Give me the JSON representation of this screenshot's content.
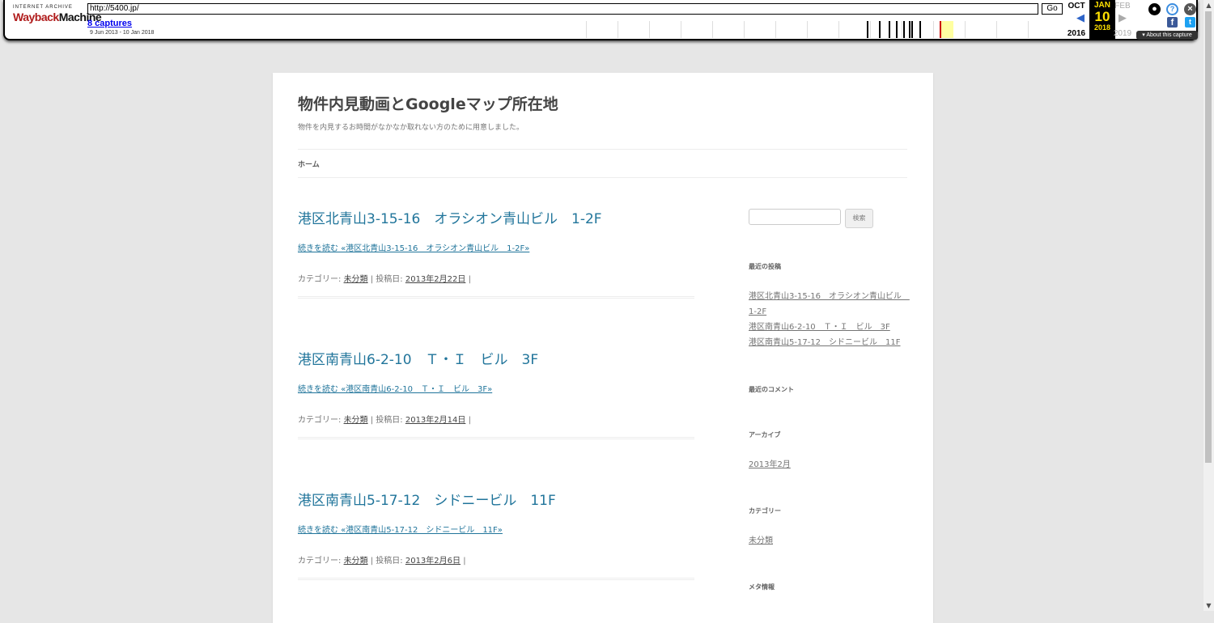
{
  "wayback": {
    "logo_top": "INTERNET ARCHIVE",
    "logo_main_a": "Wayback",
    "logo_main_b": "Machine",
    "url": "http://5400.jp/",
    "go_label": "Go",
    "captures": "8 captures",
    "range": "9 Jun 2013 - 10 Jan 2018",
    "prev_month": "OCT",
    "cur_month": "JAN",
    "next_month": "FEB",
    "prev_year": "2016",
    "cur_year": "2018",
    "next_year": "2019",
    "cur_day": "10",
    "about": "▾ About this capture"
  },
  "site": {
    "title": "物件内見動画とGoogleマップ所在地",
    "description": "物件を内見するお時間がなかなか取れない方のために用意しました。",
    "nav_home": "ホーム"
  },
  "posts": [
    {
      "title": "港区北青山3-15-16　オラシオン青山ビル　1-2F",
      "more": "続きを読む «港区北青山3-15-16　オラシオン青山ビル　1-2F»",
      "meta_prefix": "カテゴリー: ",
      "category": "未分類",
      "meta_mid": " | 投稿日: ",
      "date": "2013年2月22日",
      "meta_suffix": " |"
    },
    {
      "title": "港区南青山6-2-10　Ｔ・Ｉ　ビル　3F",
      "more": "続きを読む «港区南青山6-2-10　Ｔ・Ｉ　ビル　3F»",
      "meta_prefix": "カテゴリー: ",
      "category": "未分類",
      "meta_mid": " | 投稿日: ",
      "date": "2013年2月14日",
      "meta_suffix": " |"
    },
    {
      "title": "港区南青山5-17-12　シドニービル　11F",
      "more": "続きを読む «港区南青山5-17-12　シドニービル　11F»",
      "meta_prefix": "カテゴリー: ",
      "category": "未分類",
      "meta_mid": " | 投稿日: ",
      "date": "2013年2月6日",
      "meta_suffix": " |"
    }
  ],
  "sidebar": {
    "search_button": "検索",
    "recent_posts_title": "最近の投稿",
    "recent_posts": [
      "港区北青山3-15-16　オラシオン青山ビル　",
      "1-2F",
      "港区南青山6-2-10　Ｔ・Ｉ　ビル　3F",
      "港区南青山5-17-12　シドニービル　11F"
    ],
    "recent_comments_title": "最近のコメント",
    "archives_title": "アーカイブ",
    "archive_item": "2013年2月",
    "categories_title": "カテゴリー",
    "category_item": "未分類",
    "meta_title": "メタ情報"
  }
}
